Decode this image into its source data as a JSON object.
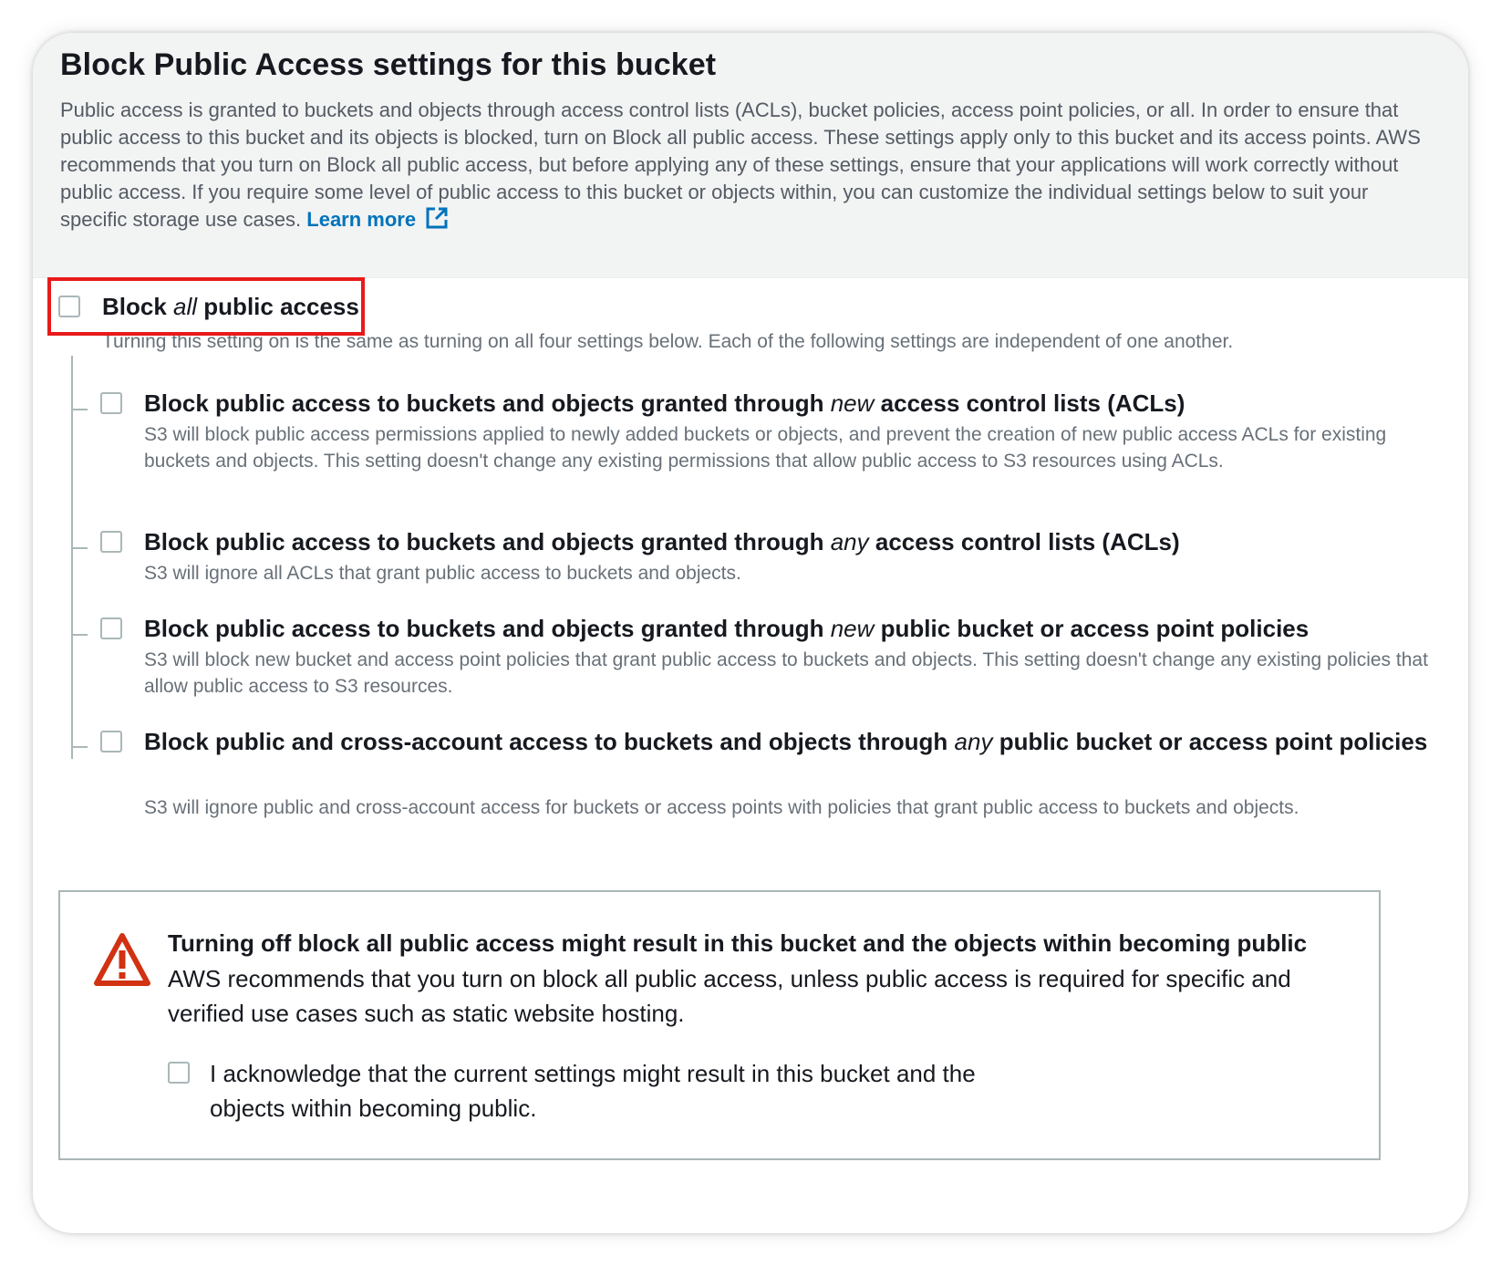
{
  "header": {
    "title": "Block Public Access settings for this bucket",
    "description": "Public access is granted to buckets and objects through access control lists (ACLs), bucket policies, access point policies, or all. In order to ensure that public access to this bucket and its objects is blocked, turn on Block all public access. These settings apply only to this bucket and its access points. AWS recommends that you turn on Block all public access, but before applying any of these settings, ensure that your applications will work correctly without public access. If you require some level of public access to this bucket or objects within, you can customize the individual settings below to suit your specific storage use cases.",
    "learn_more": "Learn more"
  },
  "block_all": {
    "label_prefix": "Block",
    "label_em": "all",
    "label_suffix": "public access",
    "description": "Turning this setting on is the same as turning on all four settings below. Each of the following settings are independent of one another.",
    "checked": false
  },
  "settings": [
    {
      "label_prefix": "Block public access to buckets and objects granted through",
      "label_em": "new",
      "label_suffix": "access control lists (ACLs)",
      "description": "S3 will block public access permissions applied to newly added buckets or objects, and prevent the creation of new public access ACLs for existing buckets and objects. This setting doesn't change any existing permissions that allow public access to S3 resources using ACLs.",
      "checked": false
    },
    {
      "label_prefix": "Block public access to buckets and objects granted through",
      "label_em": "any",
      "label_suffix": "access control lists (ACLs)",
      "description": "S3 will ignore all ACLs that grant public access to buckets and objects.",
      "checked": false
    },
    {
      "label_prefix": "Block public access to buckets and objects granted through",
      "label_em": "new",
      "label_suffix": "public bucket or access point policies",
      "description": "S3 will block new bucket and access point policies that grant public access to buckets and objects. This setting doesn't change any existing policies that allow public access to S3 resources.",
      "checked": false
    },
    {
      "label_prefix": "Block public and cross-account access to buckets and objects through",
      "label_em": "any",
      "label_suffix": "public bucket or access point policies",
      "description": "S3 will ignore public and cross-account access for buckets or access points with policies that grant public access to buckets and objects.",
      "checked": false
    }
  ],
  "warning": {
    "icon": "warning-triangle-icon",
    "title": "Turning off block all public access might result in this bucket and the objects within becoming public",
    "text": "AWS recommends that you turn on block all public access, unless public access is required for specific and verified use cases such as static website hosting.",
    "acknowledge_label": "I acknowledge that the current settings might result in this bucket and the objects within becoming public.",
    "acknowledge_checked": false
  },
  "colors": {
    "link": "#0073bb",
    "highlight": "#e81a1a",
    "warning": "#d13212",
    "header_bg": "#f2f3f3"
  }
}
